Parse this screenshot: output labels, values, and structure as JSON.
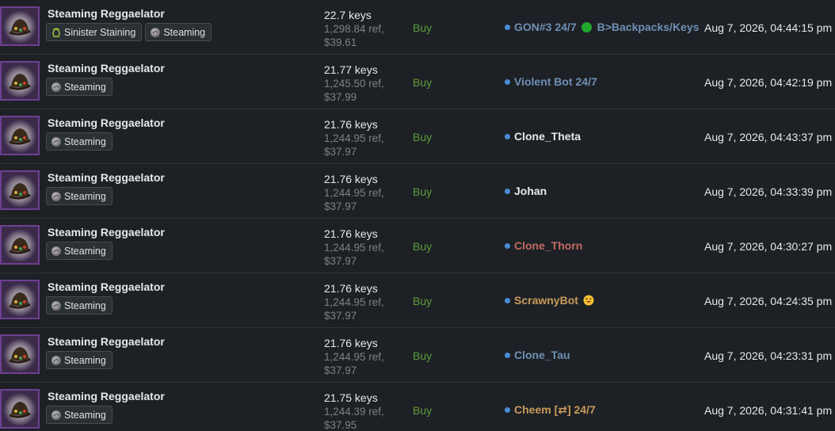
{
  "colors": {
    "background": "#1d2125",
    "buy_intent": "#5d9d3a",
    "online_dot": "#4a8bd6",
    "user_default": "#6f8fb4",
    "user_white": "#e8e8e8",
    "user_red": "#c26a62",
    "user_gold": "#c99a5b",
    "item_border": "#6e3f92"
  },
  "listings": [
    {
      "item_name": "Steaming Reggaelator",
      "tags": [
        {
          "label": "Sinister Staining",
          "icon": "paint-can-icon"
        },
        {
          "label": "Steaming",
          "icon": "unusual-effect-icon"
        }
      ],
      "price_keys": "22.7 keys",
      "price_ref": "1,298.84 ref,",
      "price_usd": "$39.61",
      "intent": "Buy",
      "user": "GON#3 24/7",
      "user_suffix": "B>Backpacks/Keys",
      "user_color": "#6f8fb4",
      "user_badge": "green-status-icon",
      "date": "Aug 7, 2026, 04:44:15 pm"
    },
    {
      "item_name": "Steaming Reggaelator",
      "tags": [
        {
          "label": "Steaming",
          "icon": "unusual-effect-icon"
        }
      ],
      "price_keys": "21.77 keys",
      "price_ref": "1,245.50 ref,",
      "price_usd": "$37.99",
      "intent": "Buy",
      "user": "Violent Bot 24/7",
      "user_color": "#6f8fb4",
      "date": "Aug 7, 2026, 04:42:19 pm"
    },
    {
      "item_name": "Steaming Reggaelator",
      "tags": [
        {
          "label": "Steaming",
          "icon": "unusual-effect-icon"
        }
      ],
      "price_keys": "21.76 keys",
      "price_ref": "1,244.95 ref,",
      "price_usd": "$37.97",
      "intent": "Buy",
      "user": "Clone_Theta",
      "user_color": "#e8e8e8",
      "date": "Aug 7, 2026, 04:43:37 pm"
    },
    {
      "item_name": "Steaming Reggaelator",
      "tags": [
        {
          "label": "Steaming",
          "icon": "unusual-effect-icon"
        }
      ],
      "price_keys": "21.76 keys",
      "price_ref": "1,244.95 ref,",
      "price_usd": "$37.97",
      "intent": "Buy",
      "user": "Johan",
      "user_color": "#e8e8e8",
      "date": "Aug 7, 2026, 04:33:39 pm"
    },
    {
      "item_name": "Steaming Reggaelator",
      "tags": [
        {
          "label": "Steaming",
          "icon": "unusual-effect-icon"
        }
      ],
      "price_keys": "21.76 keys",
      "price_ref": "1,244.95 ref,",
      "price_usd": "$37.97",
      "intent": "Buy",
      "user": "Clone_Thorn",
      "user_color": "#c26a62",
      "date": "Aug 7, 2026, 04:30:27 pm"
    },
    {
      "item_name": "Steaming Reggaelator",
      "tags": [
        {
          "label": "Steaming",
          "icon": "unusual-effect-icon"
        }
      ],
      "price_keys": "21.76 keys",
      "price_ref": "1,244.95 ref,",
      "price_usd": "$37.97",
      "intent": "Buy",
      "user": "ScrawnyBot",
      "user_color": "#c99a5b",
      "user_emoji": "tongue-face-emoji-icon",
      "date": "Aug 7, 2026, 04:24:35 pm"
    },
    {
      "item_name": "Steaming Reggaelator",
      "tags": [
        {
          "label": "Steaming",
          "icon": "unusual-effect-icon"
        }
      ],
      "price_keys": "21.76 keys",
      "price_ref": "1,244.95 ref,",
      "price_usd": "$37.97",
      "intent": "Buy",
      "user": "Clone_Tau",
      "user_color": "#6f8fb4",
      "date": "Aug 7, 2026, 04:23:31 pm"
    },
    {
      "item_name": "Steaming Reggaelator",
      "tags": [
        {
          "label": "Steaming",
          "icon": "unusual-effect-icon"
        }
      ],
      "price_keys": "21.75 keys",
      "price_ref": "1,244.39 ref,",
      "price_usd": "$37.95",
      "intent": "Buy",
      "user": "Cheem [⇄] 24/7",
      "user_color": "#c99a5b",
      "date": "Aug 7, 2026, 04:31:41 pm"
    }
  ]
}
